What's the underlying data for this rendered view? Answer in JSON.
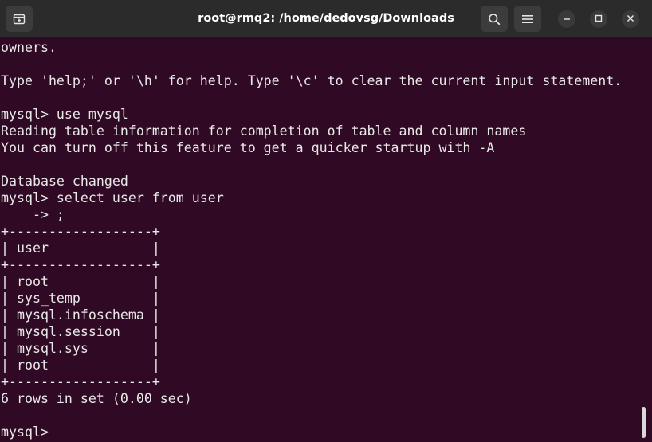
{
  "window": {
    "title": "root@rmq2: /home/dedovsg/Downloads",
    "icons": {
      "new_tab": "new-tab-icon",
      "search": "search-icon",
      "menu": "hamburger-menu-icon",
      "minimize": "minimize-icon",
      "maximize": "maximize-icon",
      "close": "close-icon"
    }
  },
  "colors": {
    "background": "#300a24",
    "titlebar": "#2b2b2b",
    "text": "#e8e8e8"
  },
  "terminal": {
    "lines": [
      "owners.",
      "",
      "Type 'help;' or '\\h' for help. Type '\\c' to clear the current input statement.",
      "",
      "mysql> use mysql",
      "Reading table information for completion of table and column names",
      "You can turn off this feature to get a quicker startup with -A",
      "",
      "Database changed",
      "mysql> select user from user",
      "    -> ;",
      "+------------------+",
      "| user             |",
      "+------------------+",
      "| root             |",
      "| sys_temp         |",
      "| mysql.infoschema |",
      "| mysql.session    |",
      "| mysql.sys        |",
      "| root             |",
      "+------------------+",
      "6 rows in set (0.00 sec)",
      "",
      "mysql> "
    ]
  }
}
